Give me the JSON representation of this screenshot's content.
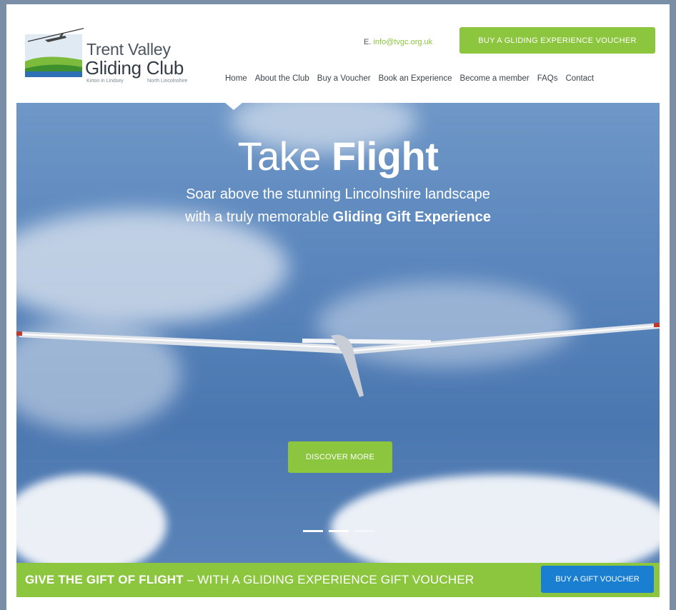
{
  "logo": {
    "name_line1": "Trent Valley",
    "name_line2": "Gliding Club",
    "location_left": "Kirton in Lindsey",
    "location_right": "North Lincolnshire"
  },
  "header": {
    "email_label": "E.",
    "email": "info@tvgc.org.uk",
    "voucher_button": "BUY A GLIDING EXPERIENCE VOUCHER"
  },
  "nav": {
    "items": [
      "Home",
      "About the Club",
      "Buy a Voucher",
      "Book an Experience",
      "Become a member",
      "FAQs",
      "Contact"
    ]
  },
  "hero": {
    "title_light": "Take",
    "title_bold": "Flight",
    "subtitle_line1": "Soar above the stunning Lincolnshire landscape",
    "subtitle_line2_prefix": "with a truly memorable",
    "subtitle_line2_bold": "Gliding Gift Experience",
    "discover_button": "DISCOVER MORE",
    "slides": 3,
    "active_slide": 1
  },
  "promo": {
    "bold_text": "GIVE THE GIFT OF FLIGHT",
    "rest_text": " – WITH A GLIDING EXPERIENCE GIFT VOUCHER",
    "button": "BUY A GIFT VOUCHER"
  },
  "colors": {
    "accent_green": "#8cc63f",
    "gift_button_blue": "#1a7fd0",
    "sky_blue": "#5a86bd"
  }
}
